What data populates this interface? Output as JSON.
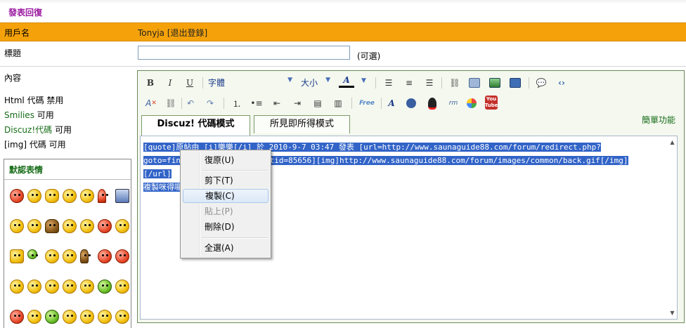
{
  "page_title": "發表回復",
  "user_row": {
    "label": "用戶名",
    "username": "Tonyja",
    "logout_link": "[退出登錄]"
  },
  "title_row": {
    "label": "標題",
    "value": "",
    "optional": "(可選)"
  },
  "content_row": {
    "label": "內容",
    "options": [
      {
        "prefix": "Html 代碼",
        "state": "禁用"
      },
      {
        "prefix": "Smilies",
        "state": "可用"
      },
      {
        "prefix": "Discuz!代碼",
        "state": "可用"
      },
      {
        "prefix": "[img] 代碼",
        "state": "可用"
      }
    ]
  },
  "smilies": {
    "title": "默認表情"
  },
  "toolbar": {
    "bold": "B",
    "italic": "I",
    "underline": "U",
    "font_select": "字體",
    "size_select": "大小",
    "color_btn": "A",
    "free_icon": "Free",
    "youtube_top": "You",
    "youtube_bottom": "Tube"
  },
  "tabs": {
    "code_mode": "Discuz! 代碼模式",
    "wysiwyg_mode": "所見即所得模式"
  },
  "simple_mode_link": "簡單功能",
  "editor": {
    "line1": "[quote]原帖由 [i]樂樂[/i] 於 2010-9-7 03:47 發表 [url=http://www.saunaguide88.com/forum/redirect.php?",
    "line2_pre": "goto=fin",
    "line2_post": "ptid=85656][img]http://www.saunaguide88.com/forum/images/common/back.gif[/img]",
    "line3": "[/url]",
    "line4": "複製咪得囉"
  },
  "context_menu": {
    "undo": "復原(U)",
    "cut": "剪下(T)",
    "copy": "複製(C)",
    "paste": "貼上(P)",
    "delete": "刪除(D)",
    "select_all": "全選(A)"
  },
  "colors": {
    "accent_orange": "#f5a20a",
    "title_purple": "#9a1aa0",
    "label_green": "#176c18",
    "selection_blue": "#3264c8"
  }
}
